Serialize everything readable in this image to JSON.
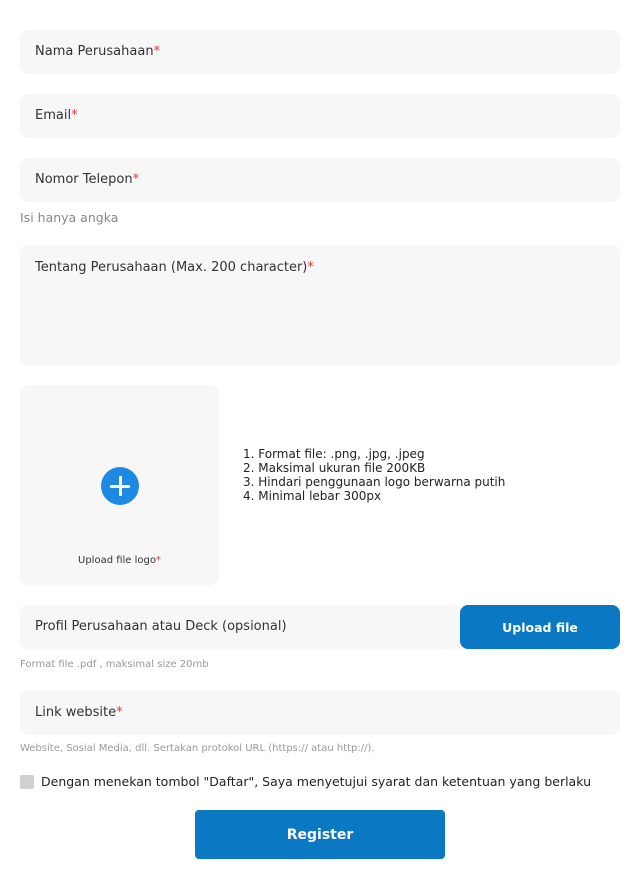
{
  "form": {
    "company_name_label": "Nama Perusahaan",
    "email_label": "Email",
    "phone_label": "Nomor Telepon",
    "phone_hint": "Isi hanya angka",
    "about_label": "Tentang Perusahaan (Max. 200 character)",
    "required_mark": "*"
  },
  "logo_upload": {
    "icon": "plus-icon",
    "label": "Upload file logo",
    "rules": [
      "1. Format file: .png, .jpg, .jpeg",
      "2. Maksimal ukuran file 200KB",
      "3. Hindari penggunaan logo berwarna putih",
      "4. Minimal lebar 300px"
    ]
  },
  "profile_upload": {
    "label": "Profil Perusahaan atau Deck (opsional)",
    "button": "Upload file",
    "hint": "Format file .pdf , maksimal size 20mb"
  },
  "website": {
    "label": "Link website",
    "hint": "Website, Sosial Media, dll. Sertakan protokol URL (https:// atau http://)."
  },
  "agreement": {
    "text": "Dengan menekan tombol \"Daftar\", Saya menyetujui syarat dan ketentuan yang berlaku",
    "checked": false
  },
  "register_button": "Register",
  "colors": {
    "field_bg": "#f7f7f7",
    "primary": "#0a78c2",
    "plus_icon": "#1e88e5",
    "required": "#e53935"
  }
}
